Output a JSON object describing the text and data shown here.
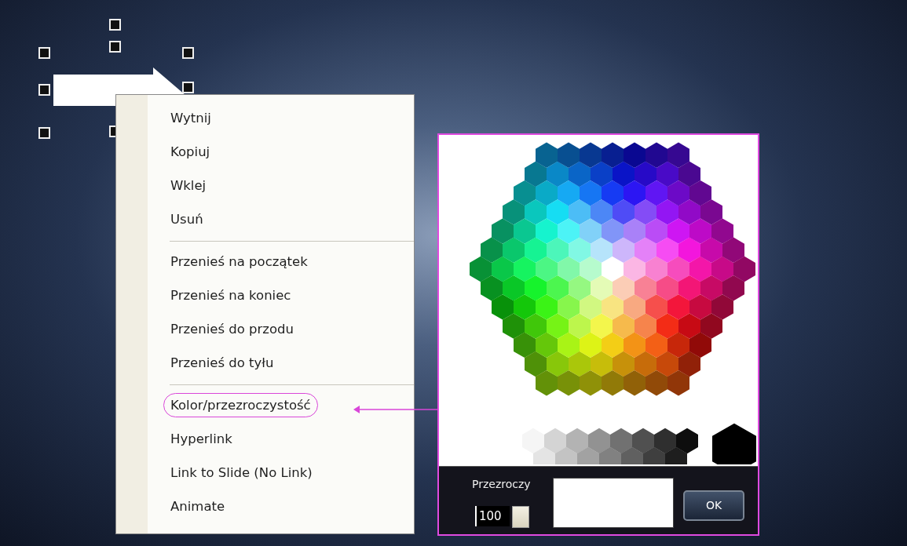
{
  "menu": {
    "groups": [
      [
        {
          "label": "Wytnij",
          "callout": false
        },
        {
          "label": "Kopiuj",
          "callout": false
        },
        {
          "label": "Wklej",
          "callout": false
        },
        {
          "label": "Usuń",
          "callout": false
        }
      ],
      [
        {
          "label": "Przenieś na początek",
          "callout": false
        },
        {
          "label": "Przenieś na koniec",
          "callout": false
        },
        {
          "label": "Przenieś do przodu",
          "callout": false
        },
        {
          "label": "Przenieś do tyłu",
          "callout": false
        }
      ],
      [
        {
          "label": "Kolor/przezroczystość",
          "callout": true
        },
        {
          "label": "Hyperlink",
          "callout": false
        },
        {
          "label": "Link to Slide (No Link)",
          "callout": false
        },
        {
          "label": "Animate",
          "callout": false
        }
      ]
    ]
  },
  "color_picker": {
    "transparency_label": "Przezroczy",
    "transparency_value": "100",
    "ok_button": "OK"
  }
}
